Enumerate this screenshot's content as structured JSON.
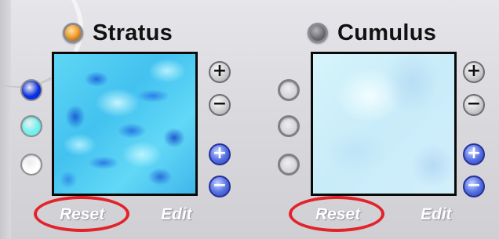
{
  "panels": {
    "stratus": {
      "title": "Stratus",
      "indicator": "on",
      "color_presets": [
        "#0a2fe0",
        "#6ff2ee",
        "#ffffff"
      ],
      "buttons": {
        "plus": "+",
        "minus": "−",
        "plus_blue": "+",
        "minus_blue": "−"
      },
      "reset_label": "Reset",
      "edit_label": "Edit"
    },
    "cumulus": {
      "title": "Cumulus",
      "indicator": "off",
      "color_presets": [
        "empty",
        "empty",
        "empty"
      ],
      "buttons": {
        "plus": "+",
        "minus": "−",
        "plus_blue": "+",
        "minus_blue": "−"
      },
      "reset_label": "Reset",
      "edit_label": "Edit"
    }
  },
  "icons": {
    "indicator": "led-icon",
    "zoom_in": "plus-icon",
    "zoom_out": "minus-icon"
  },
  "colors": {
    "highlight": "#e3222a",
    "indicator_on": "#f2a33a",
    "indicator_off": "#6e6e74"
  }
}
